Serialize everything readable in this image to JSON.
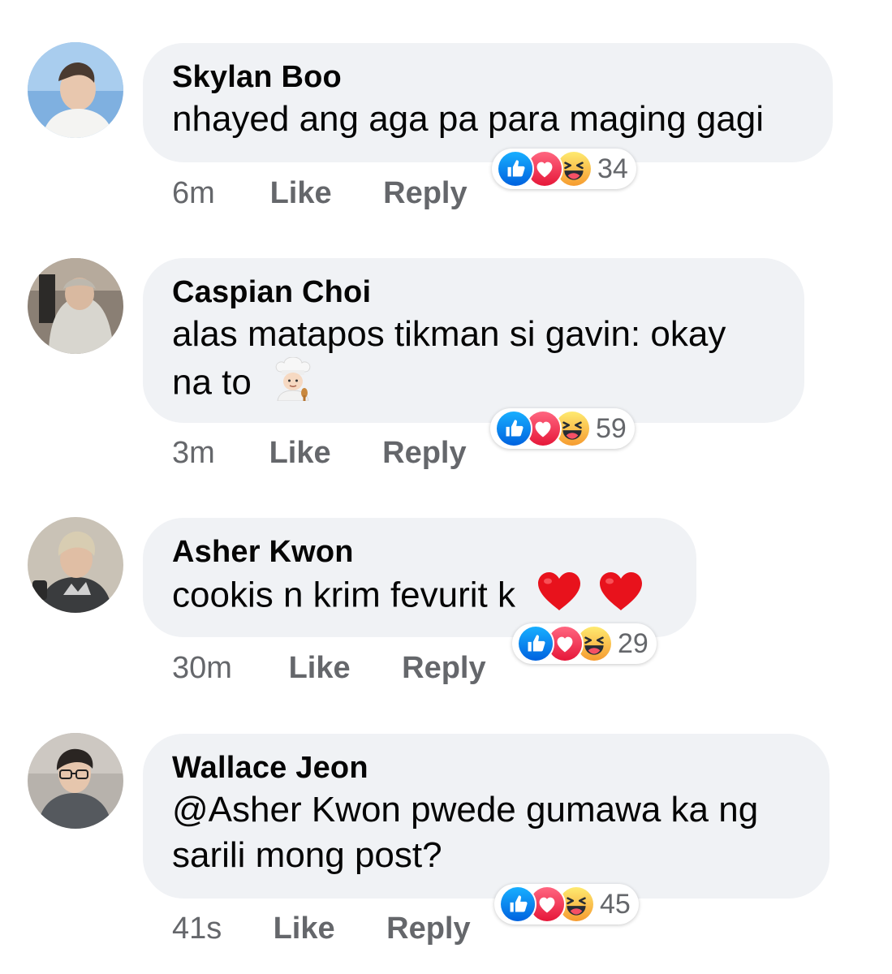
{
  "comments": [
    {
      "author": "Skylan Boo",
      "text": "nhayed ang aga pa para maging gagi",
      "time": "6m",
      "like_label": "Like",
      "reply_label": "Reply",
      "reaction_count": "34",
      "reactions": [
        "like-icon",
        "love-icon",
        "haha-icon"
      ]
    },
    {
      "author": "Caspian Choi",
      "text_line1": "alas matapos tikman si gavin: okay",
      "text_line2": "na to",
      "emoji": "cook-emoji",
      "time": "3m",
      "like_label": "Like",
      "reply_label": "Reply",
      "reaction_count": "59",
      "reactions": [
        "like-icon",
        "love-icon",
        "haha-icon"
      ]
    },
    {
      "author": "Asher Kwon",
      "text": "cookis n krim fevurit k",
      "emoji": "red-heart-emoji",
      "time": "30m",
      "like_label": "Like",
      "reply_label": "Reply",
      "reaction_count": "29",
      "reactions": [
        "like-icon",
        "love-icon",
        "haha-icon"
      ]
    },
    {
      "author": "Wallace Jeon",
      "text_line1": "@Asher Kwon pwede gumawa ka ng",
      "text_line2": "sarili mong post?",
      "time": "41s",
      "like_label": "Like",
      "reply_label": "Reply",
      "reaction_count": "45",
      "reactions": [
        "like-icon",
        "love-icon",
        "haha-icon"
      ]
    }
  ],
  "colors": {
    "bubble": "#f0f2f5",
    "meta": "#65676b",
    "like_blue": "#1877f2",
    "love_red": "#f33e58",
    "haha_yellow": "#f7b125"
  }
}
